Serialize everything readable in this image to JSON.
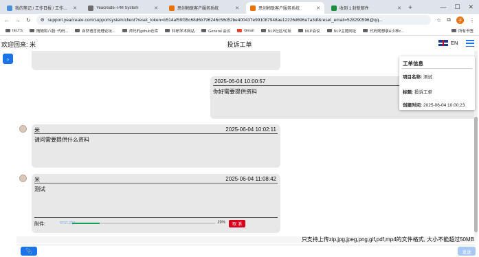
{
  "browser": {
    "tabs": [
      {
        "title": "我的笔记 / 工作日报 / 工作日报",
        "color": "#4a90d9",
        "active": false
      },
      {
        "title": "Yeacreate--PM System",
        "color": "#6c6c6c",
        "active": false
      },
      {
        "title": "思创物联客户服务系统",
        "color": "#e8710a",
        "active": false
      },
      {
        "title": "思创物联客户服务系统",
        "color": "#e8710a",
        "active": true
      },
      {
        "title": "收到 1 封新邮件",
        "color": "#1e8e3e",
        "active": false
      }
    ],
    "url": "support.yeacreate.com/supportsystem/client?reset_token=b514af59f35c68d6b796246c58d52be400437e991087948ae12226d696a7a3df&reset_email=528290596@qq...",
    "profile_initial": "子",
    "bookmarks": [
      "IELTS",
      "随随和八股: 代码...",
      "自然语言处理论坛...",
      "师兄的github仓库",
      "科研学术网站",
      "General 会议",
      "Gmail",
      "NLP社区/论坛",
      "NLP会议",
      "NLP主题网址",
      "代码随想录&小林c...",
      "所有书签"
    ]
  },
  "header": {
    "welcome": "欢迎回来: 米",
    "title": "投诉工单",
    "lang": "EN"
  },
  "messages": [
    {
      "side": "right",
      "time": "2025-06-04 10:00:57",
      "text": "你好需要提供资料"
    },
    {
      "side": "left",
      "name": "米",
      "time": "2025-06-04 10:02:11",
      "text": "请问需要提供什么资料"
    },
    {
      "side": "left",
      "name": "米",
      "time": "2025-06-04 11:08:42",
      "text": "测试",
      "attachment": {
        "label": "附件:",
        "filename": "test.zip",
        "progress": 0.19,
        "percent_text": "19%",
        "cancel_label": "取 消"
      }
    }
  ],
  "info_panel": {
    "title": "工单信息",
    "project_label": "项目名称:",
    "project_value": "测试",
    "subject_label": "标题:",
    "subject_value": "投诉工单",
    "created_label": "创建时间:",
    "created_value": "2025-06-04 10:00:23"
  },
  "footer": {
    "notice": "只支持上传zip,jpg,jpeg,png,gif,pdf,mp4的文件格式, 大小不能超过50MB",
    "send_label": "发送",
    "input_placeholder": ""
  },
  "colors": {
    "accent": "#1a73e8",
    "cancel": "#d9001b",
    "progress": "#18a058",
    "bubble": "#e8e8e8"
  }
}
